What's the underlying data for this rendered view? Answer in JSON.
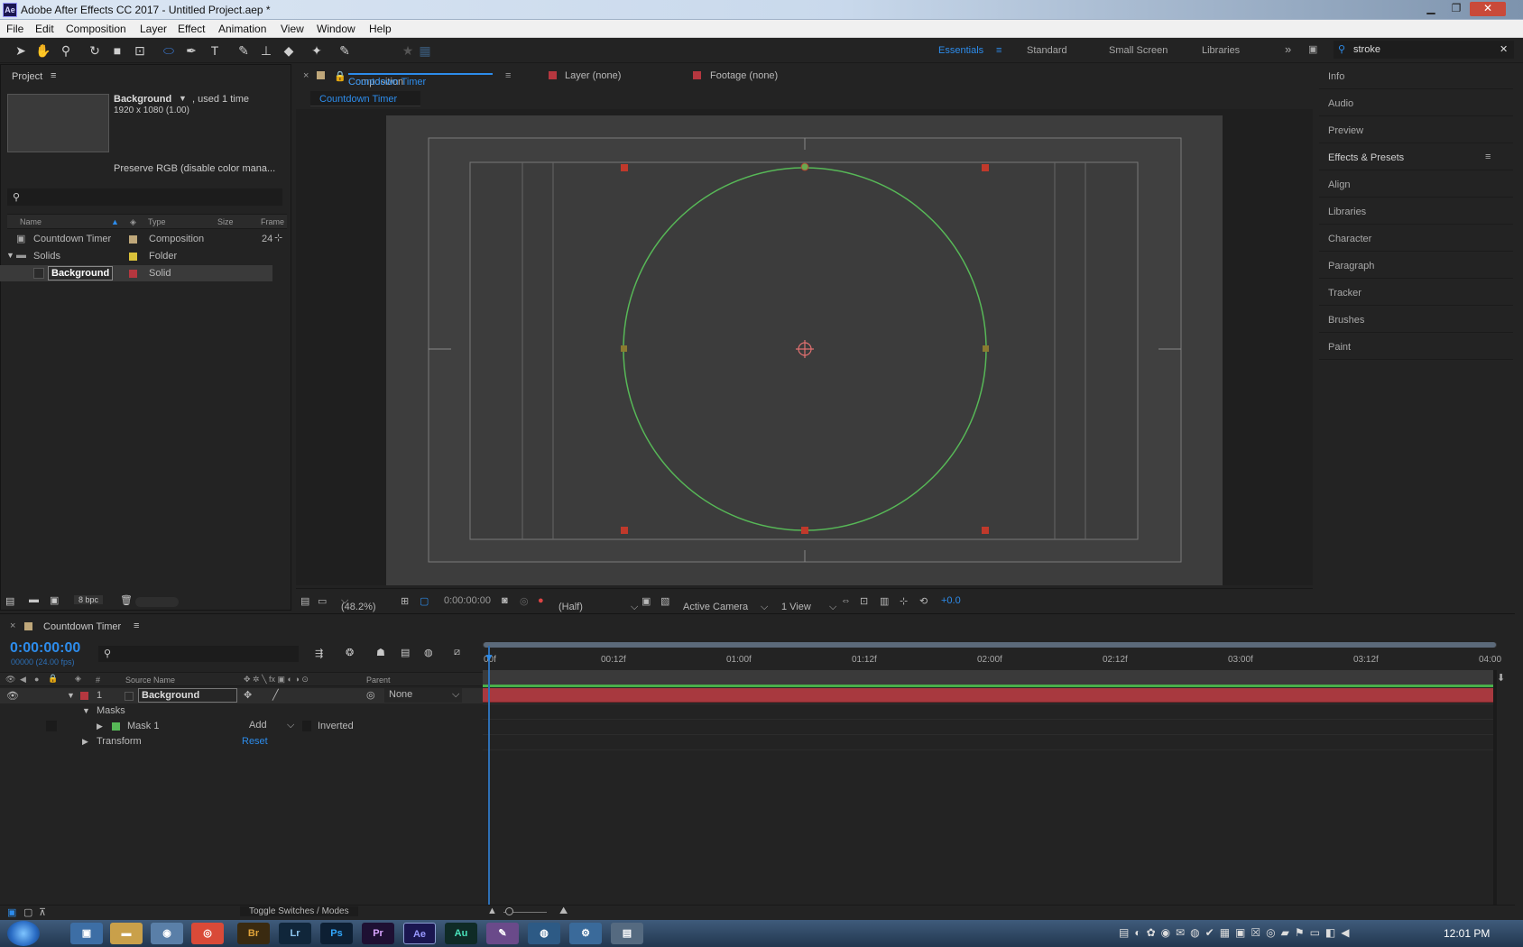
{
  "window": {
    "title": "Adobe After Effects CC 2017 - Untitled Project.aep *",
    "app_icon": "Ae"
  },
  "menu": [
    "File",
    "Edit",
    "Composition",
    "Layer",
    "Effect",
    "Animation",
    "View",
    "Window",
    "Help"
  ],
  "workspaces": {
    "active": "Essentials",
    "items": [
      "Standard",
      "Small Screen",
      "Libraries"
    ]
  },
  "search": {
    "value": "stroke"
  },
  "project": {
    "title": "Project",
    "selected_name": "Background",
    "used": ", used 1 time",
    "dimensions": "1920 x 1080 (1.00)",
    "color_note": "Preserve RGB (disable color mana...",
    "columns": {
      "name": "Name",
      "type": "Type",
      "size": "Size",
      "frame": "Frame"
    },
    "items": [
      {
        "name": "Countdown Timer",
        "type": "Composition",
        "frame": "24"
      },
      {
        "name": "Solids",
        "type": "Folder"
      },
      {
        "name": "Background",
        "type": "Solid"
      }
    ],
    "bpc": "8 bpc"
  },
  "viewer": {
    "tab_comp_prefix": "Composition",
    "tab_comp_name": "Countdown Timer",
    "tab_layer": "Layer (none)",
    "tab_footage": "Footage (none)",
    "breadcrumb": "Countdown Timer",
    "zoom": "(48.2%)",
    "time": "0:00:00:00",
    "resolution": "(Half)",
    "camera": "Active Camera",
    "views": "1 View",
    "exposure": "+0.0"
  },
  "right_panel": [
    "Info",
    "Audio",
    "Preview",
    "Effects & Presets",
    "Align",
    "Libraries",
    "Character",
    "Paragraph",
    "Tracker",
    "Brushes",
    "Paint"
  ],
  "timeline": {
    "tab": "Countdown Timer",
    "timecode": "0:00:00:00",
    "frame_info": "00000 (24.00 fps)",
    "col_num": "#",
    "col_source": "Source Name",
    "col_parent": "Parent",
    "ruler": [
      "00f",
      "00:12f",
      "01:00f",
      "01:12f",
      "02:00f",
      "02:12f",
      "03:00f",
      "03:12f",
      "04:00"
    ],
    "layer": {
      "num": "1",
      "name": "Background",
      "parent": "None"
    },
    "masks_label": "Masks",
    "mask": {
      "name": "Mask 1",
      "mode": "Add",
      "inverted": "Inverted"
    },
    "transform": {
      "label": "Transform",
      "reset": "Reset"
    },
    "footer": "Toggle Switches / Modes"
  },
  "taskbar": {
    "clock": "12:01 PM",
    "apps": [
      "Br",
      "Lr",
      "Ps",
      "Pr",
      "Ae",
      "Au"
    ]
  },
  "colors": {
    "accent": "#2d8ceb",
    "mask_green": "#57b857",
    "layer_red": "#b5373f",
    "comp_bg": "#3d3d3d"
  }
}
